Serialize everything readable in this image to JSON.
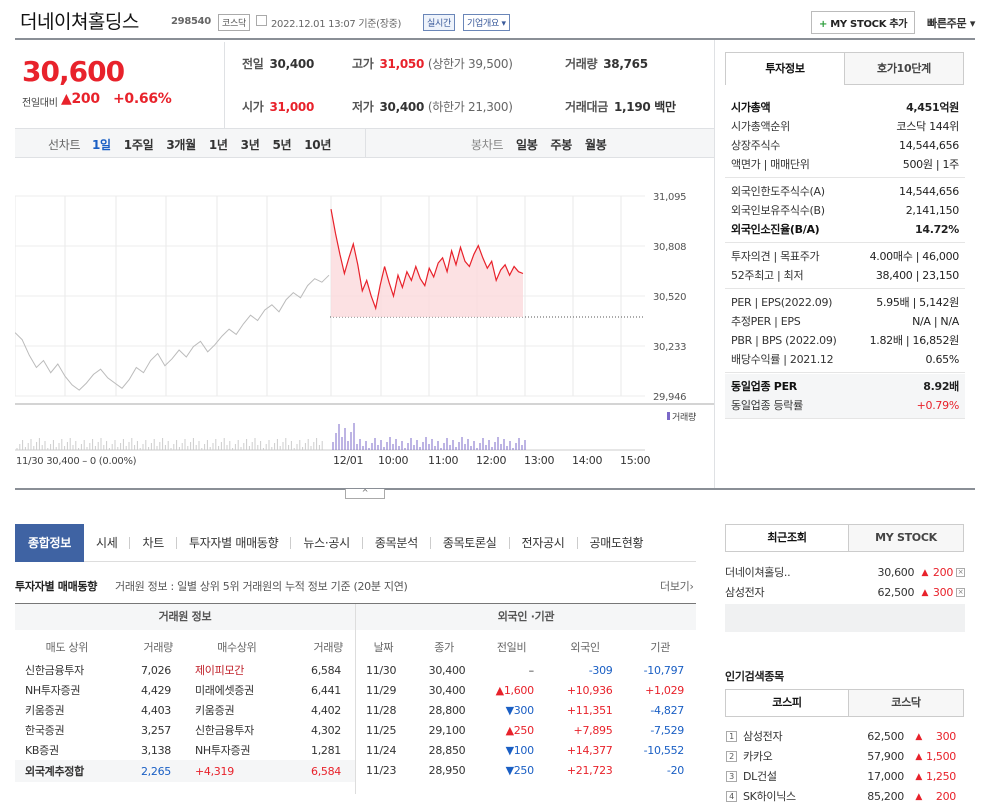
{
  "header": {
    "name": "더네이쳐홀딩스",
    "code": "298540",
    "market": "코스닥",
    "datetime": "2022.12.01 13:07",
    "basis": "기준(장중)",
    "realtime": "실시간",
    "company_info": "기업개요",
    "mystock_btn": "MY STOCK 추가",
    "quick_order": "빠른주문"
  },
  "price": {
    "current": "30,600",
    "change_label": "전일대비",
    "change": "▲200",
    "pct": "+0.66%"
  },
  "summary": {
    "prev_label": "전일",
    "prev": "30,400",
    "high_label": "고가",
    "high": "31,050",
    "upper": "(상한가 39,500)",
    "vol_label": "거래량",
    "vol": "38,765",
    "open_label": "시가",
    "open": "31,000",
    "low_label": "저가",
    "low": "30,400",
    "lower": "(하한가 21,300)",
    "amt_label": "거래대금",
    "amt": "1,190 백만"
  },
  "chart_tabs": {
    "line_label": "선차트",
    "periods": [
      "1일",
      "1주일",
      "3개월",
      "1년",
      "3년",
      "5년",
      "10년"
    ],
    "candle_label": "봉차트",
    "candles": [
      "일봉",
      "주봉",
      "월봉"
    ]
  },
  "chart_data": {
    "type": "line",
    "y_ticks": [
      "31,095",
      "30,808",
      "30,520",
      "30,233",
      "29,946"
    ],
    "x_ticks": [
      "12/01",
      "10:00",
      "11:00",
      "12:00",
      "13:00",
      "14:00",
      "15:00"
    ],
    "volume_label": "거래량",
    "prev_day": "11/30 30,400 – 0 (0.00%)",
    "ylim": [
      29946,
      31095
    ],
    "prev_close": 30400,
    "prev_series": [
      30310,
      30270,
      30180,
      30110,
      30150,
      30080,
      30130,
      30060,
      30010,
      29980,
      30020,
      30070,
      30100,
      30050,
      30020,
      29990,
      30040,
      30110,
      30080,
      30150,
      30190,
      30120,
      30160,
      30210,
      30170,
      30230,
      30260,
      30200,
      30240,
      30290,
      30330,
      30300,
      30360,
      30410,
      30380,
      30440,
      30470,
      30430,
      30500,
      30540,
      30510,
      30580,
      30620,
      30600,
      30640
    ],
    "today_series": [
      31020,
      30880,
      30760,
      30650,
      30740,
      30820,
      30700,
      30550,
      30610,
      30520,
      30450,
      30580,
      30690,
      30600,
      30520,
      30640,
      30570,
      30660,
      30610,
      30690,
      30620,
      30580,
      30680,
      30630,
      30710,
      30740,
      30660,
      30780,
      30700,
      30800,
      30720,
      30690,
      30760,
      30810,
      30740,
      30680,
      30720,
      30610,
      30670,
      30700,
      30640,
      30690,
      30660,
      30650
    ]
  },
  "right_panel": {
    "tabs": [
      "투자정보",
      "호가10단계"
    ],
    "rows1": [
      {
        "k": "시가총액",
        "v": "4,451억원",
        "bold": true
      },
      {
        "k": "시가총액순위",
        "v": "코스닥 144위"
      },
      {
        "k": "상장주식수",
        "v": "14,544,656"
      },
      {
        "k": "액면가 | 매매단위",
        "v": "500원 | 1주"
      }
    ],
    "rows2": [
      {
        "k": "외국인한도주식수(A)",
        "v": "14,544,656"
      },
      {
        "k": "외국인보유주식수(B)",
        "v": "2,141,150"
      },
      {
        "k": "외국인소진율(B/A)",
        "v": "14.72%",
        "bold": true
      }
    ],
    "rows3": [
      {
        "k": "투자의견 | 목표주가",
        "v": "4.00매수 | 46,000"
      },
      {
        "k": "52주최고 | 최저",
        "v": "38,400 | 23,150"
      }
    ],
    "rows4": [
      {
        "k": "PER | EPS(2022.09)",
        "v": "5.95배 | 5,142원"
      },
      {
        "k": "추정PER | EPS",
        "v": "N/A | N/A"
      },
      {
        "k": "PBR | BPS (2022.09)",
        "v": "1.82배 | 16,852원"
      },
      {
        "k": "배당수익률 | 2021.12",
        "v": "0.65%"
      }
    ],
    "rows5": [
      {
        "k": "동일업종 PER",
        "v": "8.92배",
        "bold": true
      },
      {
        "k": "동일업종 등락률",
        "v": "+0.79%",
        "red": true
      }
    ]
  },
  "nav": {
    "tabs": [
      "종합정보",
      "시세",
      "차트",
      "투자자별 매매동향",
      "뉴스·공시",
      "종목분석",
      "종목토론실",
      "전자공시",
      "공매도현황"
    ]
  },
  "investor": {
    "title": "투자자별 매매동향",
    "desc": "거래원 정보 : 일별 상위 5위 거래원의 누적 정보 기준 (20분 지연)",
    "more": "더보기",
    "left_head": "거래원 정보",
    "right_head": "외국인 ·기관",
    "cols_left": [
      "매도 상위",
      "거래량",
      "매수상위",
      "거래량"
    ],
    "cols_right": [
      "날짜",
      "종가",
      "전일비",
      "외국인",
      "기관"
    ],
    "left_rows": [
      [
        "신한금융투자",
        "7,026",
        "제이피모간",
        "6,584"
      ],
      [
        "NH투자증권",
        "4,429",
        "미래에셋증권",
        "6,441"
      ],
      [
        "키움증권",
        "4,403",
        "키움증권",
        "4,402"
      ],
      [
        "한국증권",
        "3,257",
        "신한금융투자",
        "4,302"
      ],
      [
        "KB증권",
        "3,138",
        "NH투자증권",
        "1,281"
      ]
    ],
    "foreign_row": [
      "외국계추정합",
      "2,265",
      "+4,319",
      "6,584"
    ],
    "right_rows": [
      [
        "11/30",
        "30,400",
        "–",
        "-309",
        "-10,797"
      ],
      [
        "11/29",
        "30,400",
        "▲1,600",
        "+10,936",
        "+1,029"
      ],
      [
        "11/28",
        "28,800",
        "▼300",
        "+11,351",
        "-4,827"
      ],
      [
        "11/25",
        "29,100",
        "▲250",
        "+7,895",
        "-7,529"
      ],
      [
        "11/24",
        "28,850",
        "▼100",
        "+14,377",
        "-10,552"
      ],
      [
        "11/23",
        "28,950",
        "▼250",
        "+21,723",
        "-20"
      ]
    ]
  },
  "recent": {
    "tabs": [
      "최근조회",
      "MY STOCK"
    ],
    "items": [
      [
        "더네이쳐홀딩..",
        "30,600",
        "200"
      ],
      [
        "삼성전자",
        "62,500",
        "300"
      ]
    ]
  },
  "popular": {
    "title": "인기검색종목",
    "tabs": [
      "코스피",
      "코스닥"
    ],
    "items": [
      [
        "1",
        "삼성전자",
        "62,500",
        "300"
      ],
      [
        "2",
        "카카오",
        "57,900",
        "1,500"
      ],
      [
        "3",
        "DL건설",
        "17,000",
        "1,250"
      ],
      [
        "4",
        "SK하이닉스",
        "85,200",
        "200"
      ]
    ]
  }
}
